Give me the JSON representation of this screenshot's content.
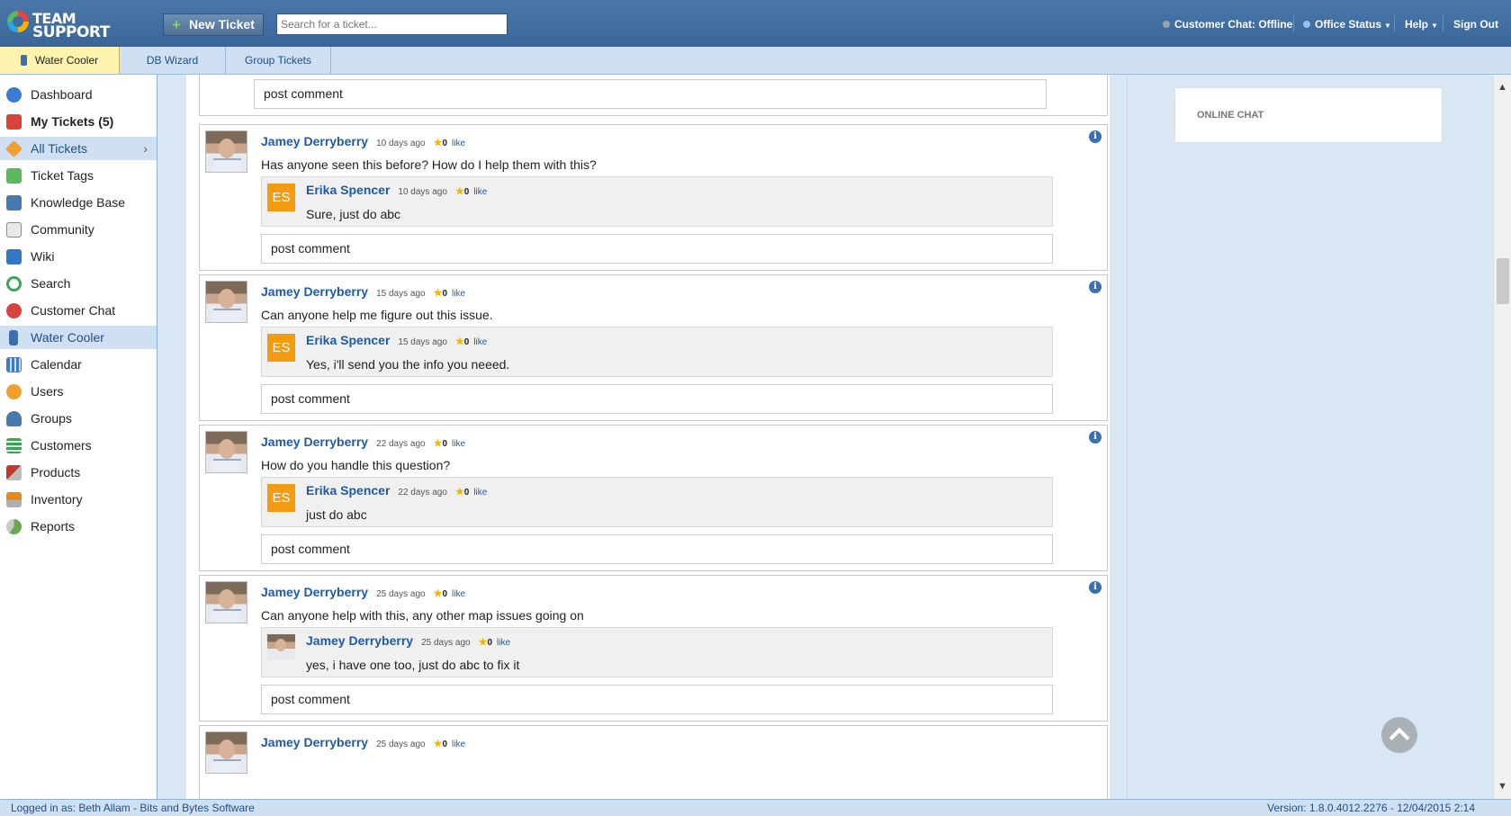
{
  "header": {
    "logo_line1": "TEAM",
    "logo_line2": "SUPPORT",
    "new_ticket_label": "New Ticket",
    "search_placeholder": "Search for a ticket...",
    "customer_chat_status": "Customer Chat: Offline",
    "office_status": "Office Status",
    "help": "Help",
    "sign_out": "Sign Out"
  },
  "tabs": [
    {
      "label": "Water Cooler",
      "active": true
    },
    {
      "label": "DB Wizard",
      "active": false
    },
    {
      "label": "Group Tickets",
      "active": false
    }
  ],
  "sidebar": {
    "items": [
      {
        "label": "Dashboard",
        "icon": "dashboard-icon",
        "color": "#3a7bd5"
      },
      {
        "label": "My Tickets (5)",
        "icon": "my-tickets-icon",
        "color": "#d9443a"
      },
      {
        "label": "All Tickets",
        "icon": "all-tickets-icon",
        "color": "#f0a030"
      },
      {
        "label": "Ticket Tags",
        "icon": "tag-icon",
        "color": "#5cb85c"
      },
      {
        "label": "Knowledge Base",
        "icon": "knowledge-base-icon",
        "color": "#4a79b0"
      },
      {
        "label": "Community",
        "icon": "community-icon",
        "color": "#8a8a8a"
      },
      {
        "label": "Wiki",
        "icon": "wiki-puzzle-icon",
        "color": "#2f78c4"
      },
      {
        "label": "Search",
        "icon": "search-icon",
        "color": "#3aa655"
      },
      {
        "label": "Customer Chat",
        "icon": "chat-icon",
        "color": "#d9443a"
      },
      {
        "label": "Water Cooler",
        "icon": "water-cooler-icon",
        "color": "#3a6fb0"
      },
      {
        "label": "Calendar",
        "icon": "calendar-icon",
        "color": "#3a7bd5"
      },
      {
        "label": "Users",
        "icon": "users-icon",
        "color": "#f0a030"
      },
      {
        "label": "Groups",
        "icon": "groups-icon",
        "color": "#4a79b0"
      },
      {
        "label": "Customers",
        "icon": "customers-icon",
        "color": "#3aa655"
      },
      {
        "label": "Products",
        "icon": "products-icon",
        "color": "#c0392b"
      },
      {
        "label": "Inventory",
        "icon": "inventory-icon",
        "color": "#e08a1e"
      },
      {
        "label": "Reports",
        "icon": "reports-icon",
        "color": "#6aa84f"
      }
    ]
  },
  "feed": {
    "top_comment_label": "post comment",
    "posts": [
      {
        "author": "Jamey Derryberry",
        "time": "10 days ago",
        "score": "0",
        "like": "like",
        "message": "Has anyone seen this before? How do I help them with this?",
        "reply": {
          "initials": "ES",
          "author": "Erika Spencer",
          "time": "10 days ago",
          "score": "0",
          "like": "like",
          "message": "Sure, just do abc"
        },
        "comment_label": "post comment"
      },
      {
        "author": "Jamey Derryberry",
        "time": "15 days ago",
        "score": "0",
        "like": "like",
        "message": "Can anyone help me figure out this issue.",
        "reply": {
          "initials": "ES",
          "author": "Erika Spencer",
          "time": "15 days ago",
          "score": "0",
          "like": "like",
          "message": "Yes, i'll send you the info you neeed."
        },
        "comment_label": "post comment"
      },
      {
        "author": "Jamey Derryberry",
        "time": "22 days ago",
        "score": "0",
        "like": "like",
        "message": "How do you handle this question?",
        "reply": {
          "initials": "ES",
          "author": "Erika Spencer",
          "time": "22 days ago",
          "score": "0",
          "like": "like",
          "message": "just do abc"
        },
        "comment_label": "post comment"
      },
      {
        "author": "Jamey Derryberry",
        "time": "25 days ago",
        "score": "0",
        "like": "like",
        "message": "Can anyone help with this, any other map issues going on",
        "reply": {
          "initials": "",
          "author": "Jamey Derryberry",
          "time": "25 days ago",
          "score": "0",
          "like": "like",
          "message": "yes, i have one too, just do abc to fix it"
        },
        "comment_label": "post comment"
      },
      {
        "author": "Jamey Derryberry",
        "time": "25 days ago",
        "score": "0",
        "like": "like"
      }
    ]
  },
  "right_panel": {
    "online_chat_label": "ONLINE CHAT"
  },
  "status_bar": {
    "logged_in": "Logged in as: Beth Allam - Bits and Bytes Software",
    "version": "Version: 1.8.0.4012.2276 - 12/04/2015 2:14"
  }
}
